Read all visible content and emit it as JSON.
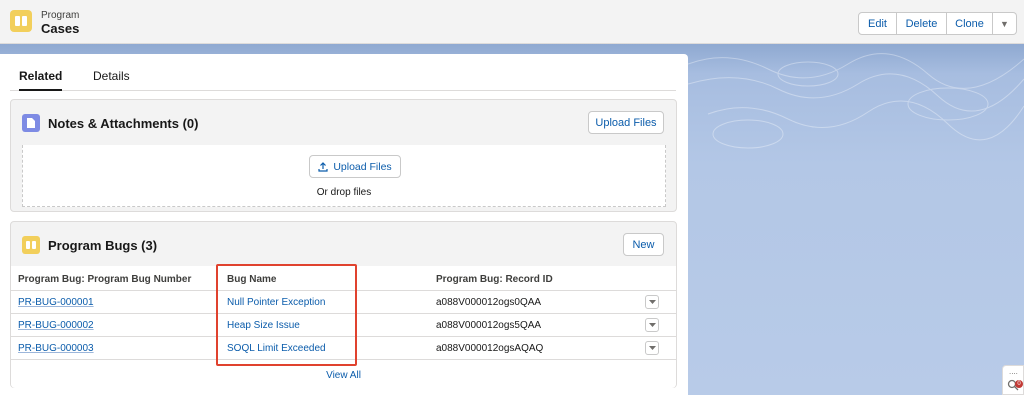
{
  "header": {
    "object_label": "Program",
    "record_title": "Cases",
    "icon": "book-icon",
    "buttons": {
      "edit": "Edit",
      "delete": "Delete",
      "clone": "Clone",
      "more": "▼"
    }
  },
  "tabs": [
    {
      "label": "Related",
      "active": true
    },
    {
      "label": "Details",
      "active": false
    }
  ],
  "notes_card": {
    "title": "Notes & Attachments (0)",
    "icon": "file-icon",
    "action_label": "Upload Files",
    "dropzone": {
      "upload_label": "Upload Files",
      "drop_text": "Or drop files"
    }
  },
  "bugs_card": {
    "title": "Program Bugs (3)",
    "icon": "book-icon",
    "action_label": "New",
    "columns": [
      "Program Bug: Program Bug Number",
      "Bug Name",
      "Program Bug: Record ID"
    ],
    "rows": [
      {
        "number": "PR-BUG-000001",
        "name": "Null Pointer Exception",
        "record_id": "a088V000012ogs0QAA"
      },
      {
        "number": "PR-BUG-000002",
        "name": "Heap Size Issue",
        "record_id": "a088V000012ogs5QAA"
      },
      {
        "number": "PR-BUG-000003",
        "name": "SOQL Limit Exceeded",
        "record_id": "a088V000012ogsAQAQ"
      }
    ],
    "view_all_label": "View All"
  },
  "utility_bar": {
    "dots": "....",
    "badge_count": "0"
  },
  "colors": {
    "accent_link": "#0b5cab",
    "object_icon": "#f2cf5b",
    "notes_icon": "#7e8be4",
    "highlight_border": "#e0422e"
  }
}
